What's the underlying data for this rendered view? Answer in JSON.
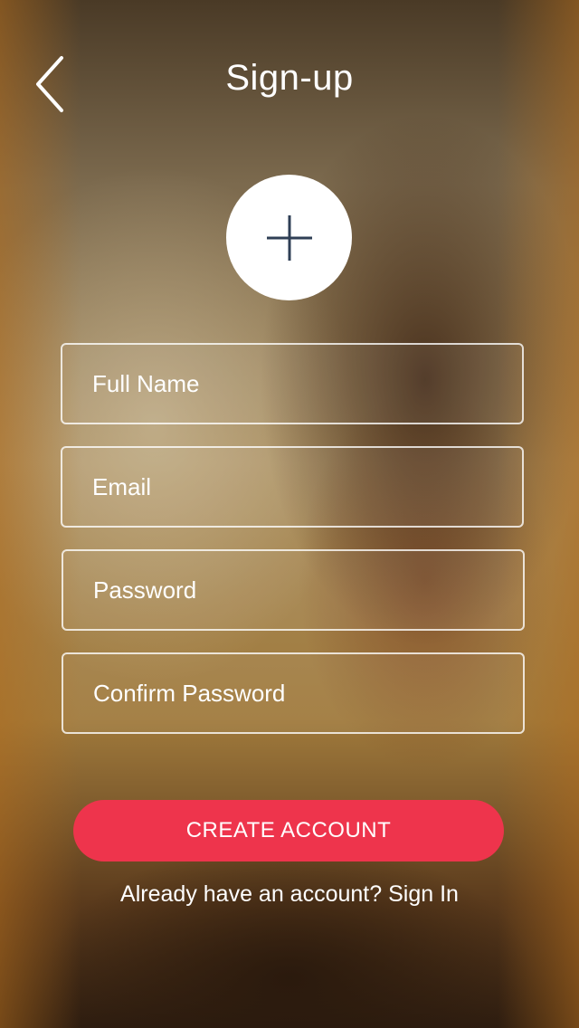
{
  "header": {
    "back_icon": "chevron-left-icon",
    "title": "Sign-up"
  },
  "avatar": {
    "icon": "plus-icon"
  },
  "form": {
    "full_name": {
      "placeholder": "Full Name",
      "value": ""
    },
    "email": {
      "placeholder": "Email",
      "value": ""
    },
    "password": {
      "placeholder": "Password",
      "value": ""
    },
    "confirm_password": {
      "placeholder": "Confirm Password",
      "value": ""
    }
  },
  "actions": {
    "create_label": "CREATE ACCOUNT",
    "signin_prompt": "Already have an account?",
    "signin_link": "Sign In"
  },
  "colors": {
    "accent": "#ee344c",
    "text": "#ffffff",
    "icon_dark": "#2f3f55"
  }
}
